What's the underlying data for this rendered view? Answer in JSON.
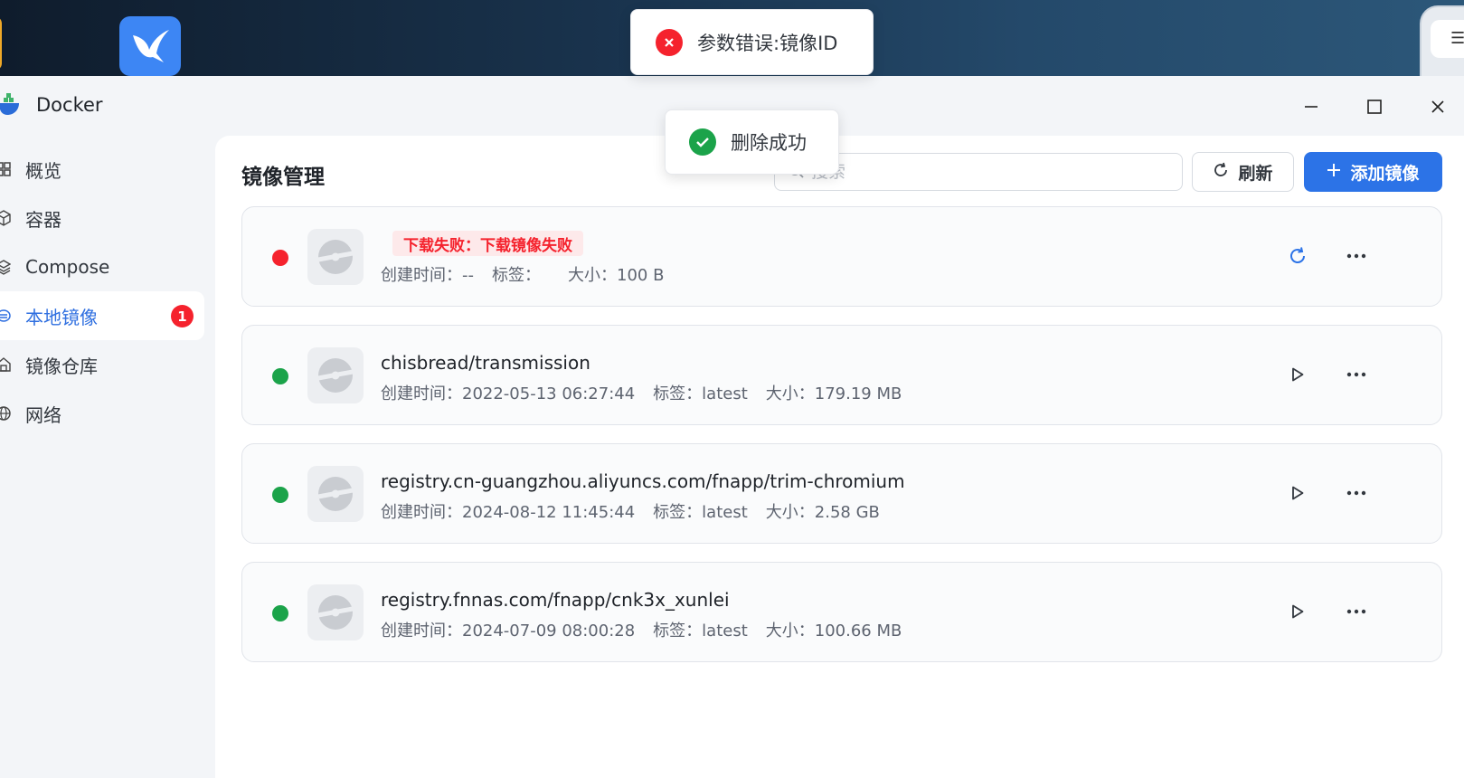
{
  "window": {
    "title": "Docker",
    "minimize_label": "—",
    "maximize_label": "☐",
    "close_label": "✕"
  },
  "sidebar": {
    "items": [
      {
        "label": "概览",
        "icon": "grid-icon"
      },
      {
        "label": "容器",
        "icon": "cube-icon"
      },
      {
        "label": "Compose",
        "icon": "layers-icon"
      },
      {
        "label": "本地镜像",
        "icon": "disc-icon",
        "active": true,
        "badge": "1"
      },
      {
        "label": "镜像仓库",
        "icon": "warehouse-icon"
      },
      {
        "label": "网络",
        "icon": "globe-icon"
      }
    ]
  },
  "main": {
    "title": "镜像管理",
    "search_placeholder": "搜索",
    "refresh_label": "刷新",
    "add_label": "添加镜像"
  },
  "images": [
    {
      "status": "error",
      "status_color": "#f5222d",
      "name": "",
      "error_tag": "下载失败：下载镜像失败",
      "created_label": "创建时间：--",
      "tag_label": "标签：",
      "size_label": "大小：100 B",
      "action": "retry"
    },
    {
      "status": "ok",
      "status_color": "#1ba34a",
      "name": "chisbread/transmission",
      "created_label": "创建时间：2022-05-13 06:27:44",
      "tag_label": "标签：latest",
      "size_label": "大小：179.19 MB",
      "action": "run"
    },
    {
      "status": "ok",
      "status_color": "#1ba34a",
      "name": "registry.cn-guangzhou.aliyuncs.com/fnapp/trim-chromium",
      "created_label": "创建时间：2024-08-12 11:45:44",
      "tag_label": "标签：latest",
      "size_label": "大小：2.58 GB",
      "action": "run"
    },
    {
      "status": "ok",
      "status_color": "#1ba34a",
      "name": "registry.fnnas.com/fnapp/cnk3x_xunlei",
      "created_label": "创建时间：2024-07-09 08:00:28",
      "tag_label": "标签：latest",
      "size_label": "大小：100.66 MB",
      "action": "run"
    }
  ],
  "toasts": {
    "error_message": "参数错误:镜像ID",
    "success_message": "删除成功"
  },
  "colors": {
    "accent": "#2c73e7",
    "error": "#f5222d",
    "success": "#1ba34a"
  }
}
